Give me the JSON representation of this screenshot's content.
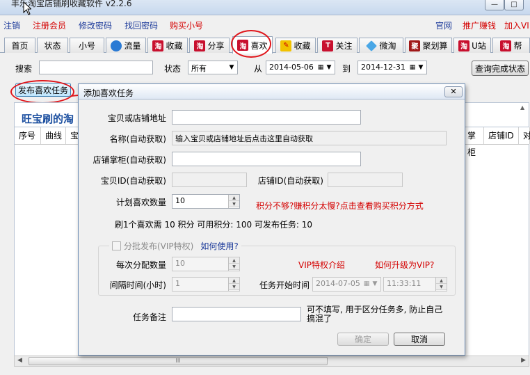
{
  "window": {
    "title": "丰乐淘宝店铺刷收藏软件 v2.2.6",
    "min_label": "—",
    "max_label": "□"
  },
  "toplinks": {
    "logout": "注销",
    "register": "注册会员",
    "change_pwd": "修改密码",
    "recover_pwd": "找回密码",
    "buy_account": "购买小号",
    "website": "官网",
    "promote": "推广赚钱",
    "join_vip": "加入VI"
  },
  "tabs": [
    {
      "label": "首页",
      "icon": ""
    },
    {
      "label": "状态",
      "icon": ""
    },
    {
      "label": "小号",
      "icon": ""
    },
    {
      "label": "流量",
      "icon": "globe-icon"
    },
    {
      "label": "收藏",
      "icon": "taobao-icon"
    },
    {
      "label": "分享",
      "icon": "taobao-icon"
    },
    {
      "label": "喜欢",
      "icon": "taobao-icon"
    },
    {
      "label": "收藏",
      "icon": "pen-icon"
    },
    {
      "label": "关注",
      "icon": "t-icon"
    },
    {
      "label": "微淘",
      "icon": "diamond-icon"
    },
    {
      "label": "聚划算",
      "icon": "ju-icon"
    },
    {
      "label": "U站",
      "icon": "taobao-icon"
    },
    {
      "label": "帮",
      "icon": "taobao-icon"
    }
  ],
  "tab_icon_text": {
    "taobao": "淘",
    "globe": "",
    "t": "T",
    "ju": "聚",
    "pen": "✎"
  },
  "toolbar": {
    "search_label": "搜索",
    "search_value": "",
    "status_label": "状态",
    "status_value": "所有",
    "from_label": "从",
    "from_date": "2014-05-06",
    "to_label": "到",
    "to_date": "2014-12-31",
    "check_button": "查询完成状态",
    "publish_button": "发布喜欢任务"
  },
  "banner_text": "旺宝刷的淘",
  "grid": {
    "columns_left": [
      "序号",
      "曲线",
      "宝"
    ],
    "columns_right": [
      "掌柜",
      "店铺ID",
      "对"
    ],
    "scroll_grip": "III"
  },
  "dialog": {
    "title": "添加喜欢任务",
    "close_label": "✕",
    "url_label": "宝贝或店铺地址",
    "url_value": "",
    "name_label": "名称(自动获取)",
    "name_value": "输入宝贝或店铺地址后点击这里自动获取",
    "seller_label": "店铺掌柜(自动获取)",
    "seller_value": "",
    "item_id_label": "宝贝ID(自动获取)",
    "item_id_value": "",
    "shop_id_label": "店铺ID(自动获取)",
    "shop_id_value": "",
    "plan_label": "计划喜欢数量",
    "plan_value": "10",
    "points_link": "积分不够?赚积分太慢?点击查看购买积分方式",
    "points_info": "刷1个喜欢需 10 积分 可用积分: 100 可发布任务: 10",
    "batch_label": "分批发布(VIP特权)",
    "how_to_use": "如何使用?",
    "per_batch_label": "每次分配数量",
    "per_batch_value": "10",
    "interval_label": "间隔时间(小时)",
    "interval_value": "1",
    "vip_intro": "VIP特权介绍",
    "vip_upgrade": "如何升级为VIP?",
    "start_label": "任务开始时间",
    "start_date": "2014-07-05",
    "start_time": "11:33:11",
    "remark_label": "任务备注",
    "remark_value": "",
    "remark_hint": "可不填写, 用于区分任务多, 防止自己搞混了",
    "ok_button": "确定",
    "cancel_button": "取消"
  },
  "colors": {
    "link_blue": "#1c3a9a",
    "link_red": "#d40000",
    "annotation_red": "#e0151b",
    "dialog_border": "#6f8fb6"
  }
}
